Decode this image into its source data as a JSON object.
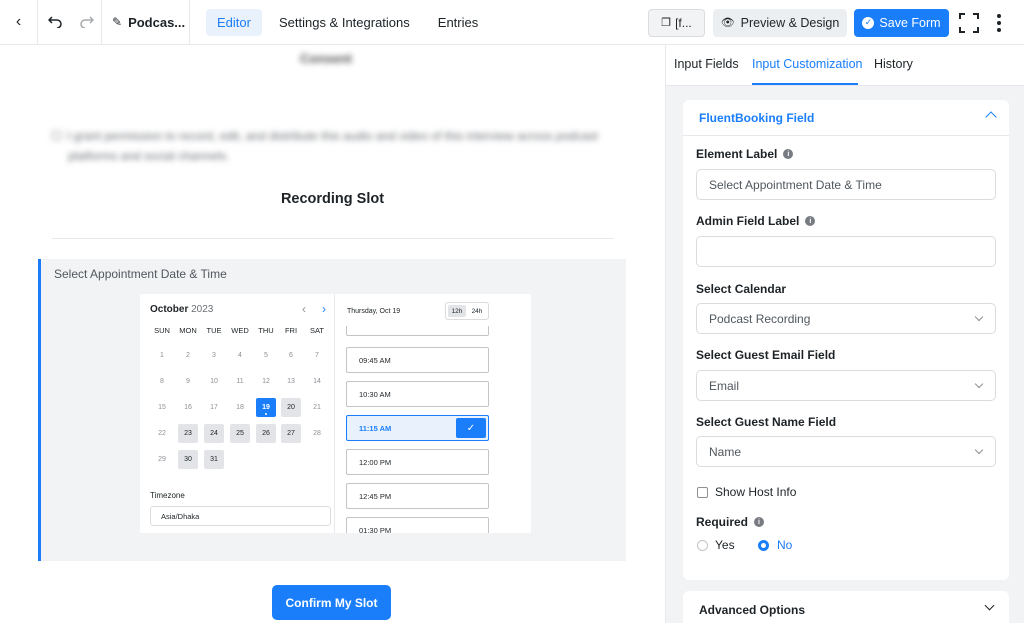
{
  "topbar": {
    "form_title": "Podcas...",
    "tabs": [
      {
        "label": "Editor",
        "active": true
      },
      {
        "label": "Settings & Integrations",
        "active": false
      },
      {
        "label": "Entries",
        "active": false
      }
    ],
    "shortcode_label": "[f...",
    "preview_label": "Preview & Design",
    "save_label": "Save Form"
  },
  "canvas": {
    "consent_title": "Consent",
    "consent_text_1": "I grant permission to record, edit, and distribute this audio and video of this interview across podcast",
    "consent_text_2": "platforms and social channels.",
    "section_title": "Recording Slot",
    "field_label": "Select Appointment Date & Time",
    "calendar": {
      "month": "October",
      "year": "2023",
      "weekdays": [
        "SUN",
        "MON",
        "TUE",
        "WED",
        "THU",
        "FRI",
        "SAT"
      ],
      "weeks": [
        [
          "1",
          "2",
          "3",
          "4",
          "5",
          "6",
          "7"
        ],
        [
          "8",
          "9",
          "10",
          "11",
          "12",
          "13",
          "14"
        ],
        [
          "15",
          "16",
          "17",
          "18",
          "19",
          "20",
          "21"
        ],
        [
          "22",
          "23",
          "24",
          "25",
          "26",
          "27",
          "28"
        ],
        [
          "29",
          "30",
          "31"
        ]
      ],
      "available_days": [
        "20",
        "23",
        "24",
        "25",
        "26",
        "27",
        "30",
        "31"
      ],
      "selected_day": "19",
      "timezone_label": "Timezone",
      "timezone_value": "Asia/Dhaka"
    },
    "slots": {
      "day_label": "Thursday, Oct 19",
      "format_12h": "12h",
      "format_24h": "24h",
      "times": [
        "09:45 AM",
        "10:30 AM",
        "11:15 AM",
        "12:00 PM",
        "12:45 PM",
        "01:30 PM"
      ],
      "selected_time": "11:15 AM"
    },
    "confirm_label": "Confirm My Slot"
  },
  "sidebar": {
    "tabs": [
      {
        "label": "Input Fields",
        "active": false
      },
      {
        "label": "Input Customization",
        "active": true
      },
      {
        "label": "History",
        "active": false
      }
    ],
    "panel_title": "FluentBooking Field",
    "element_label": "Element Label",
    "element_value": "Select Appointment Date & Time",
    "admin_label": "Admin Field Label",
    "admin_value": "",
    "calendar_label": "Select Calendar",
    "calendar_value": "Podcast Recording",
    "email_label": "Select Guest Email Field",
    "email_value": "Email",
    "name_label": "Select Guest Name Field",
    "name_value": "Name",
    "host_info_label": "Show Host Info",
    "required_label": "Required",
    "required_yes": "Yes",
    "required_no": "No",
    "advanced_label": "Advanced Options"
  },
  "colors": {
    "accent": "#1a7efb",
    "sidebar_bg": "#f2f3f5"
  }
}
